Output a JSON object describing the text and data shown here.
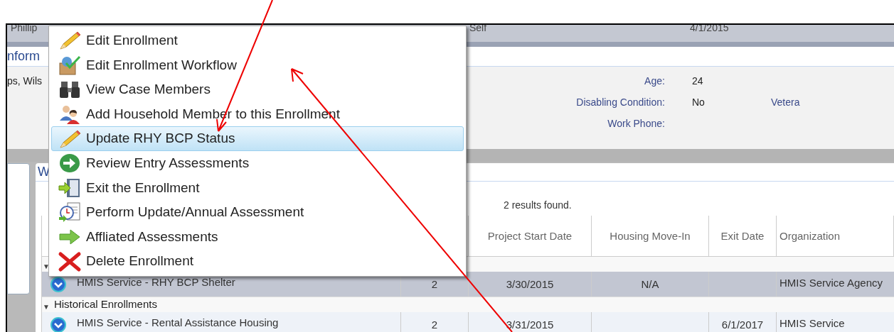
{
  "top_row": {
    "cells": [
      "Phillip",
      "Self",
      "4/1/2015"
    ]
  },
  "info_panel": {
    "title": "nform",
    "name_fragment": "ps, Wils",
    "fields": [
      {
        "label": "Age:",
        "value": "24"
      },
      {
        "label": "Disabling Condition:",
        "value": "No"
      },
      {
        "label": "Work Phone:"
      }
    ],
    "cut_label": "Vetera"
  },
  "enrollments": {
    "tab": "W",
    "results": "2 results found.",
    "columns": [
      "Project Start Date",
      "Housing Move-In",
      "Exit Date",
      "Organization"
    ],
    "groups": [
      {
        "toggle": "▼",
        "expanded": true,
        "rows": [
          {
            "selected": true,
            "name": "HMIS Service - RHY BCP Shelter",
            "count": "2",
            "start": "3/30/2015",
            "move_in": "N/A",
            "exit": "",
            "organization": "HMIS Service Agency"
          }
        ]
      },
      {
        "toggle": "▼",
        "label": "Historical Enrollments",
        "expanded": true,
        "rows": [
          {
            "selected": false,
            "name": "HMIS Service - Rental Assistance Housing",
            "count": "2",
            "start": "3/31/2015",
            "move_in": "",
            "exit": "6/1/2017",
            "organization": "HMIS Service"
          }
        ]
      }
    ]
  },
  "context_menu": {
    "items": [
      {
        "label": "Edit Enrollment",
        "selected": false
      },
      {
        "label": "Edit Enrollment Workflow",
        "selected": false
      },
      {
        "label": "View Case Members",
        "selected": false
      },
      {
        "label": "Add Household Member to this Enrollment",
        "selected": false
      },
      {
        "label": "Update RHY BCP Status",
        "selected": true
      },
      {
        "label": "Review Entry Assessments",
        "selected": false
      },
      {
        "label": "Exit the Enrollment",
        "selected": false
      },
      {
        "label": "Perform Update/Annual Assessment",
        "selected": false
      },
      {
        "label": "Affliated Assessments",
        "selected": false
      },
      {
        "label": "Delete Enrollment",
        "selected": false
      }
    ]
  }
}
